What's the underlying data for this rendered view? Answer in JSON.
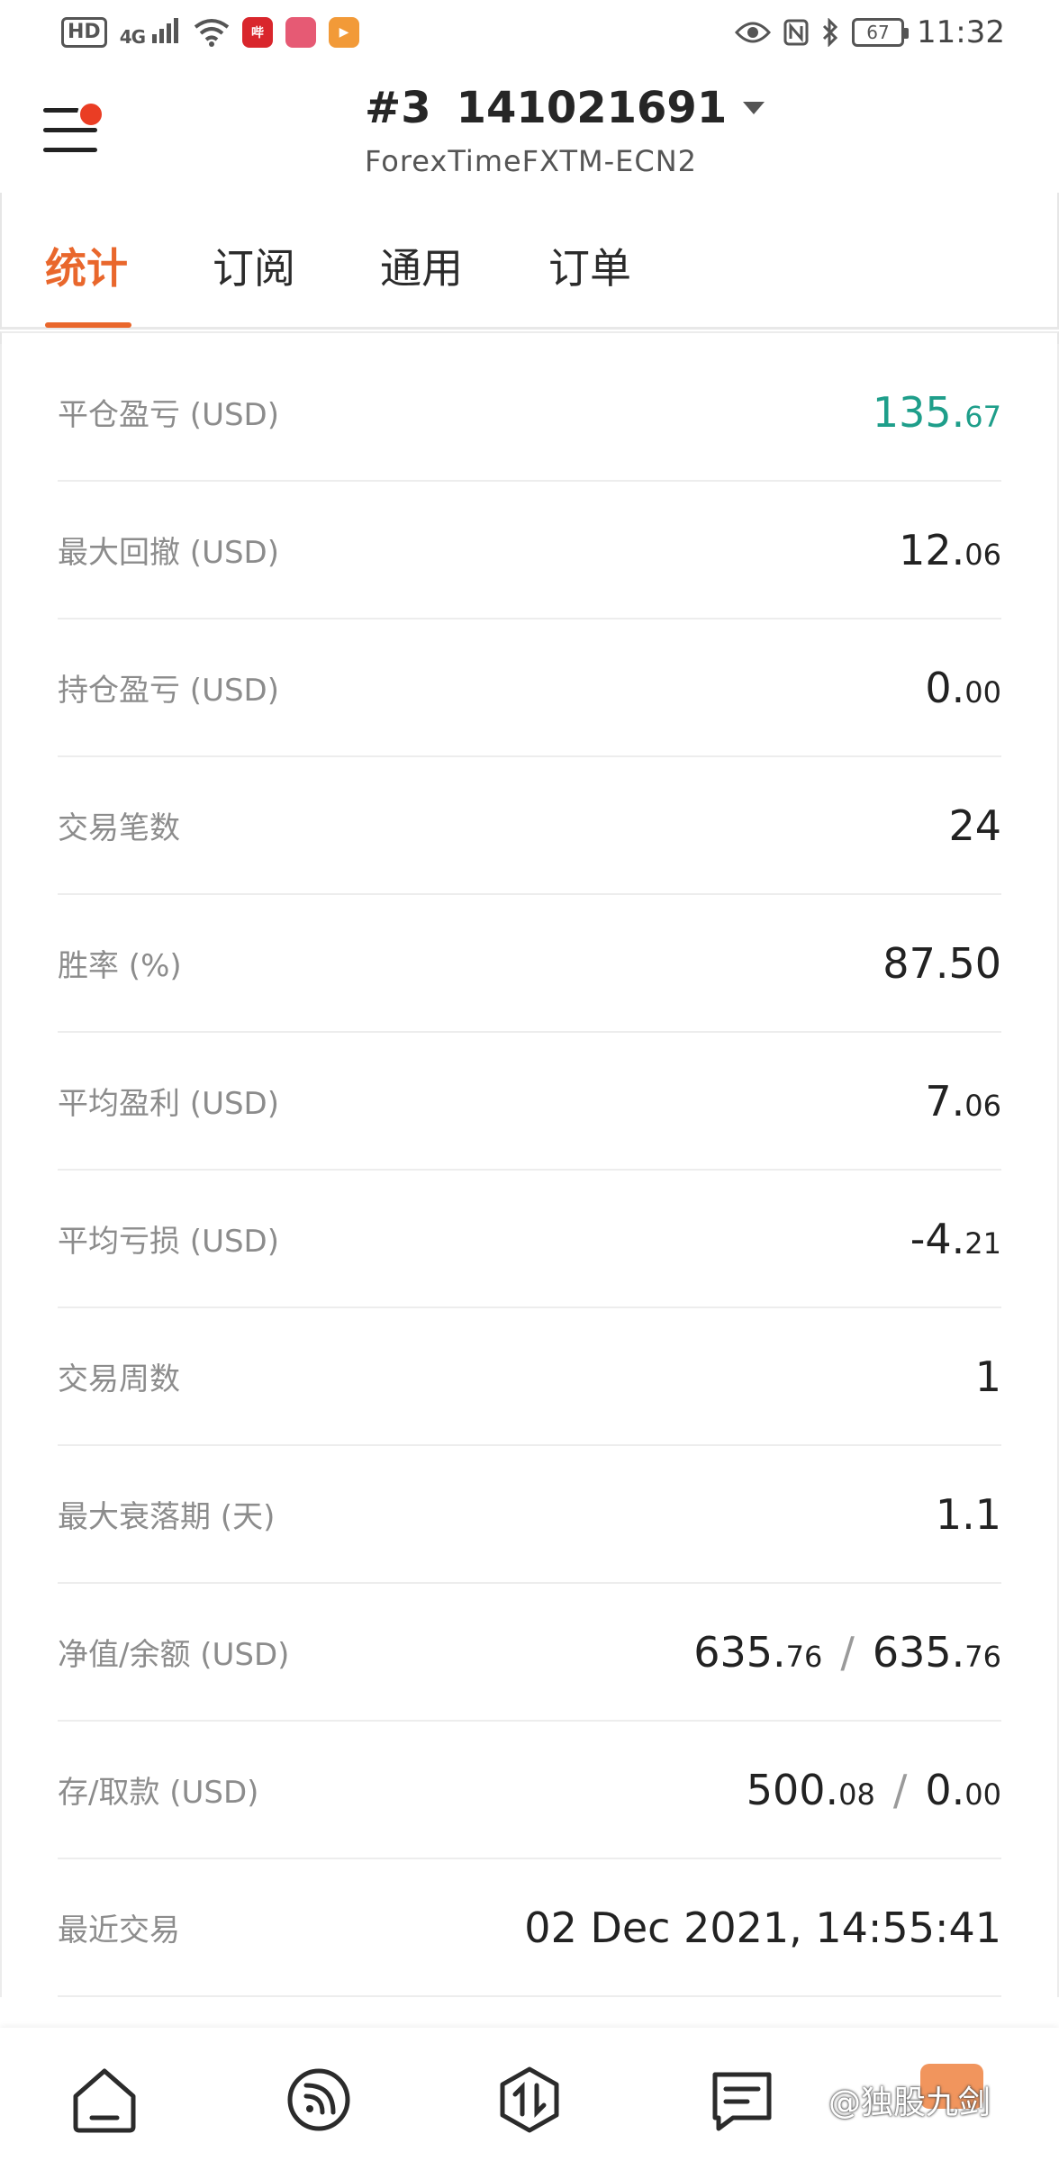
{
  "status_bar": {
    "hd": "HD",
    "signal": "4G",
    "battery": "67",
    "time": "11:32",
    "app_badges": [
      {
        "label": "哔",
        "color": "#d9262c"
      },
      {
        "label": "",
        "color": "#e65a74"
      },
      {
        "label": "",
        "color": "#f29a38"
      }
    ]
  },
  "header": {
    "account_index": "#3",
    "account_number": "141021691",
    "server": "ForexTimeFXTM-ECN2"
  },
  "tabs": [
    "统计",
    "订阅",
    "通用",
    "订单"
  ],
  "active_tab": 0,
  "stats": [
    {
      "label": "平仓盈亏 (USD)",
      "int": "135.",
      "dec": "67",
      "color": "green"
    },
    {
      "label": "最大回撤 (USD)",
      "int": "12.",
      "dec": "06"
    },
    {
      "label": "持仓盈亏 (USD)",
      "int": "0.",
      "dec": "00"
    },
    {
      "label": "交易笔数",
      "int": "24",
      "dec": ""
    },
    {
      "label": "胜率 (%)",
      "int": "87.50",
      "dec": ""
    },
    {
      "label": "平均盈利 (USD)",
      "int": "7.",
      "dec": "06"
    },
    {
      "label": "平均亏损 (USD)",
      "int": "-4.",
      "dec": "21"
    },
    {
      "label": "交易周数",
      "int": "1",
      "dec": ""
    },
    {
      "label": "最大衰落期 (天)",
      "int": "1.1",
      "dec": ""
    },
    {
      "label": "净值/余额 (USD)",
      "int": "635.",
      "dec": "76",
      "int2": "635.",
      "dec2": "76"
    },
    {
      "label": "存/取款 (USD)",
      "int": "500.",
      "dec": "08",
      "int2": "0.",
      "dec2": "00"
    },
    {
      "label": "最近交易",
      "int": "02 Dec 2021, 14:55:41",
      "dec": ""
    }
  ],
  "watermark": "@独股九剑",
  "colors": {
    "accent": "#e9672c",
    "profit": "#1e9e8a",
    "notification": "#ea3d24"
  }
}
